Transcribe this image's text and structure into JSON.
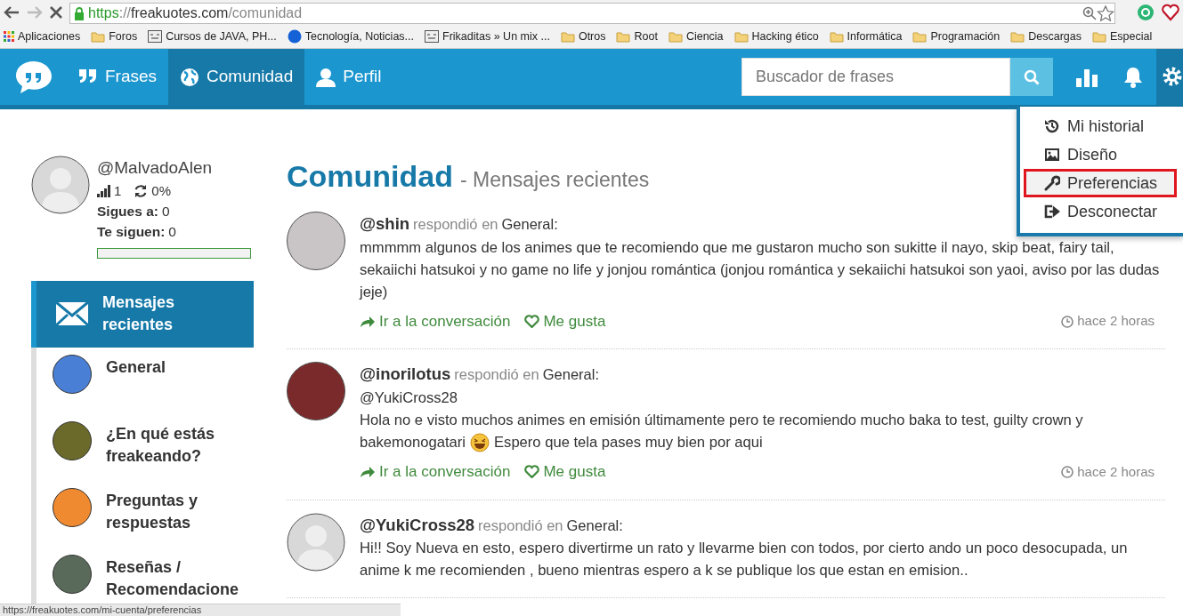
{
  "browser": {
    "url": {
      "scheme": "https",
      "separator": "://",
      "host": "freakuotes.com",
      "path": "/comunidad"
    },
    "bookmarks": [
      {
        "kind": "apps",
        "label": "Aplicaciones"
      },
      {
        "kind": "folder",
        "label": "Foros"
      },
      {
        "kind": "site",
        "label": "Cursos de JAVA, PH..."
      },
      {
        "kind": "globe",
        "label": "Tecnología, Noticias..."
      },
      {
        "kind": "site",
        "label": "Frikaditas » Un mix ..."
      },
      {
        "kind": "folder",
        "label": "Otros"
      },
      {
        "kind": "folder",
        "label": "Root"
      },
      {
        "kind": "folder",
        "label": "Ciencia"
      },
      {
        "kind": "folder",
        "label": "Hacking ético"
      },
      {
        "kind": "folder",
        "label": "Informática"
      },
      {
        "kind": "folder",
        "label": "Programación"
      },
      {
        "kind": "folder",
        "label": "Descargas"
      },
      {
        "kind": "folder",
        "label": "Especial"
      }
    ]
  },
  "navbar": {
    "items": [
      {
        "kind": "quote",
        "label": "Frases",
        "selected": false
      },
      {
        "kind": "globe",
        "label": "Comunidad",
        "selected": true
      },
      {
        "kind": "user",
        "label": "Perfil",
        "selected": false
      }
    ],
    "search": {
      "placeholder": "Buscador de frases"
    },
    "settings_open": true
  },
  "settings_menu": [
    {
      "kind": "history",
      "label": "Mi historial",
      "highlighted": false
    },
    {
      "kind": "image",
      "label": "Diseño",
      "highlighted": false
    },
    {
      "kind": "wrench",
      "label": "Preferencias",
      "highlighted": true
    },
    {
      "kind": "logout",
      "label": "Desconectar",
      "highlighted": false
    }
  ],
  "profile": {
    "username": "@MalvadoAlen",
    "level": "1",
    "ratio": "0%",
    "following_label": "Sigues a:",
    "following": "0",
    "followers_label": "Te siguen:",
    "followers": "0",
    "progress": {
      "level": 0
    }
  },
  "sidebar": {
    "items": [
      {
        "kind": "mail",
        "label": "Mensajes recientes",
        "selected": true
      },
      {
        "kind": "avatar",
        "label": "General",
        "selected": false
      },
      {
        "kind": "avatar",
        "label": "¿En qué estás freakeando?",
        "selected": false
      },
      {
        "kind": "avatar",
        "label": "Preguntas y respuestas",
        "selected": false
      },
      {
        "kind": "avatar",
        "label": "Reseñas / Recomendacione",
        "selected": false
      }
    ]
  },
  "heading": {
    "title": "Comunidad",
    "subtitle": "- Mensajes recientes"
  },
  "posts": [
    {
      "kind": "photo",
      "author": "@shin",
      "action": "respondió en",
      "category": "General:",
      "lines": [
        [
          {
            "kind": "text",
            "text": "mmmmm algunos de los animes que te recomiendo que me gustaron mucho son sukitte il nayo, skip beat, fairy tail, sekaiichi hatsukoi y no game no life y jonjou romántica (jonjou romántica y sekaiichi hatsukoi son yaoi, aviso por las dudas jeje)"
          }
        ]
      ],
      "links": [
        "Ir a la conversación",
        "Me gusta"
      ],
      "time": "hace 2 horas"
    },
    {
      "kind": "photo",
      "author": "@inorilotus",
      "action": "respondió en",
      "category": "General:",
      "mention": "@YukiCross28",
      "lines": [
        [
          {
            "kind": "text",
            "text": "Hola no e visto muchos animes en emisión últimamente pero te recomiendo mucho baka to test, guilty crown y"
          }
        ],
        [
          {
            "kind": "text",
            "text": "bakemonogatari"
          },
          {
            "kind": "emoji"
          },
          {
            "kind": "text",
            "text": "Espero que tela pases muy bien por aqui"
          }
        ]
      ],
      "links": [
        "Ir a la conversación",
        "Me gusta"
      ],
      "time": "hace 2 horas"
    },
    {
      "kind": "default",
      "author": "@YukiCross28",
      "action": "respondió en",
      "category": "General:",
      "lines": [
        [
          {
            "kind": "text",
            "text": "Hi!! Soy Nueva en esto, espero divertirme un rato y llevarme bien con todos, por cierto ando un poco desocupada, un anime k me recomienden , bueno mientras espero a k se publique los que estan en emision.."
          }
        ]
      ]
    }
  ],
  "status_bar": {
    "url": "https://freakuotes.com/mi-cuenta/preferencias"
  }
}
